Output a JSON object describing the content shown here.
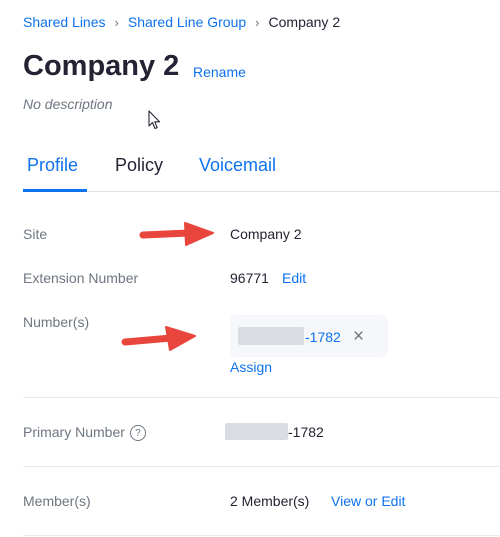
{
  "breadcrumb": {
    "items": [
      "Shared Lines",
      "Shared Line Group"
    ],
    "current": "Company 2",
    "separator": "›"
  },
  "header": {
    "title": "Company 2",
    "rename_label": "Rename",
    "description": "No description"
  },
  "tabs": {
    "items": [
      "Profile",
      "Policy",
      "Voicemail"
    ],
    "active": "Profile"
  },
  "profile": {
    "site": {
      "label": "Site",
      "value": "Company 2"
    },
    "extension": {
      "label": "Extension Number",
      "value": "96771",
      "edit_label": "Edit"
    },
    "numbers": {
      "label": "Number(s)",
      "number_suffix": "-1782",
      "remove_glyph": "×",
      "assign_label": "Assign"
    },
    "primary": {
      "label": "Primary Number",
      "help_glyph": "?",
      "number_suffix": "-1782"
    },
    "members": {
      "label": "Member(s)",
      "value": "2 Member(s)",
      "action_label": "View or Edit"
    }
  },
  "colors": {
    "accent": "#0e72ed",
    "text": "#232333",
    "muted": "#6e7680",
    "annotation_arrow": "#e8453c"
  }
}
